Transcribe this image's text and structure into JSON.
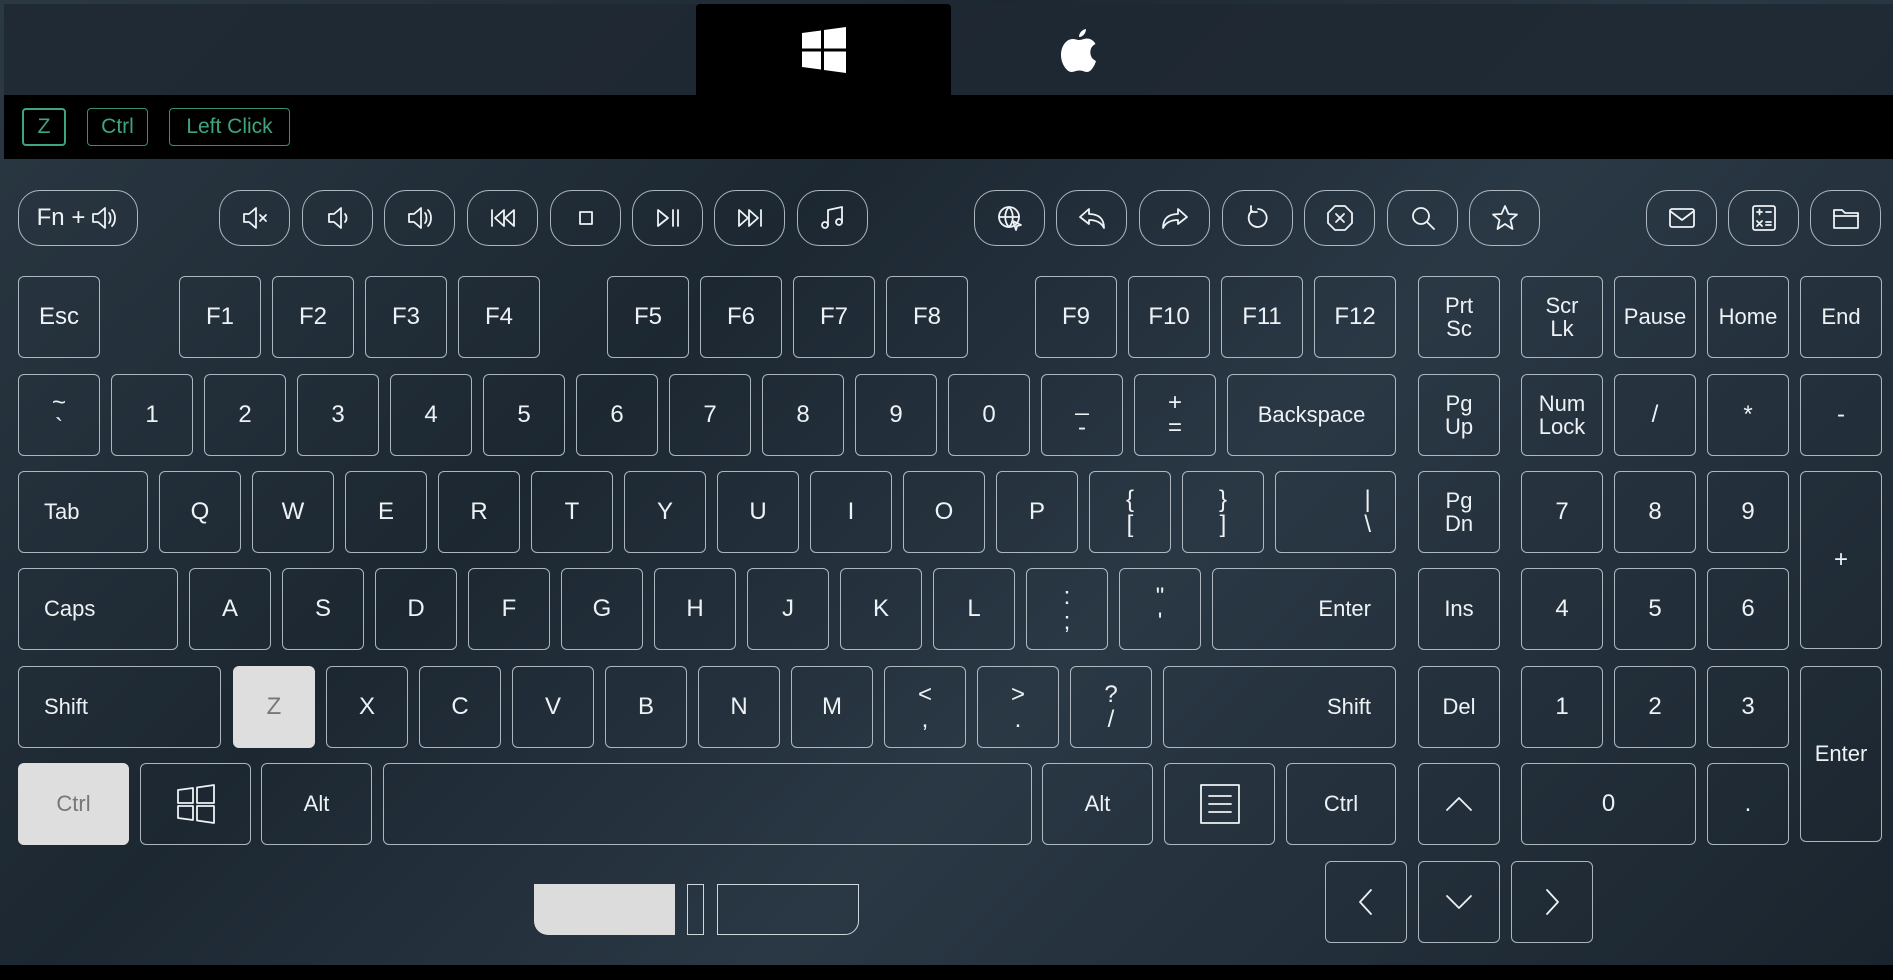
{
  "os_tabs": {
    "windows": "windows-logo",
    "mac": "apple-logo",
    "active": "windows"
  },
  "combo": {
    "key": "Z",
    "modifier": "Ctrl",
    "mouse": "Left Click",
    "accent": "#3fa57c"
  },
  "media": {
    "fn_label": "Fn +"
  },
  "keys": {
    "esc": "Esc",
    "f1": "F1",
    "f2": "F2",
    "f3": "F3",
    "f4": "F4",
    "f5": "F5",
    "f6": "F6",
    "f7": "F7",
    "f8": "F8",
    "f9": "F9",
    "f10": "F10",
    "f11": "F11",
    "f12": "F12",
    "prtsc_1": "Prt",
    "prtsc_2": "Sc",
    "scrlk_1": "Scr",
    "scrlk_2": "Lk",
    "pause": "Pause",
    "home": "Home",
    "end": "End",
    "tilde_top": "~",
    "tilde_bot": "`",
    "n1": "1",
    "n2": "2",
    "n3": "3",
    "n4": "4",
    "n5": "5",
    "n6": "6",
    "n7": "7",
    "n8": "8",
    "n9": "9",
    "n0": "0",
    "minus_top": "_",
    "minus_bot": "-",
    "plus_top": "+",
    "plus_bot": "=",
    "backspace": "Backspace",
    "pgup_1": "Pg",
    "pgup_2": "Up",
    "numlock_1": "Num",
    "numlock_2": "Lock",
    "np_div": "/",
    "np_mul": "*",
    "np_sub": "-",
    "tab": "Tab",
    "q": "Q",
    "w": "W",
    "e": "E",
    "r": "R",
    "t": "T",
    "y": "Y",
    "u": "U",
    "i": "I",
    "o": "O",
    "p": "P",
    "lbrace_top": "{",
    "lbrace_bot": "[",
    "rbrace_top": "}",
    "rbrace_bot": "]",
    "pipe_top": "|",
    "pipe_bot": "\\",
    "pgdn_1": "Pg",
    "pgdn_2": "Dn",
    "np7": "7",
    "np8": "8",
    "np9": "9",
    "np_add": "+",
    "caps": "Caps",
    "a": "A",
    "s": "S",
    "d": "D",
    "f": "F",
    "g": "G",
    "h": "H",
    "j": "J",
    "k": "K",
    "l": "L",
    "colon_top": ":",
    "colon_bot": ";",
    "quote_top": "\"",
    "quote_bot": "'",
    "enter": "Enter",
    "ins": "Ins",
    "np4": "4",
    "np5": "5",
    "np6": "6",
    "shift_l": "Shift",
    "z": "Z",
    "x": "X",
    "c": "C",
    "v": "V",
    "b": "B",
    "n": "N",
    "m": "M",
    "lt_top": "<",
    "lt_bot": ",",
    "gt_top": ">",
    "gt_bot": ".",
    "q_top": "?",
    "q_bot": "/",
    "shift_r": "Shift",
    "del": "Del",
    "np1": "1",
    "np2": "2",
    "np3": "3",
    "np_enter": "Enter",
    "ctrl_l": "Ctrl",
    "alt_l": "Alt",
    "alt_r": "Alt",
    "ctrl_r": "Ctrl",
    "np0": "0",
    "np_dot": "."
  },
  "pressed": [
    "Z",
    "Ctrl"
  ]
}
